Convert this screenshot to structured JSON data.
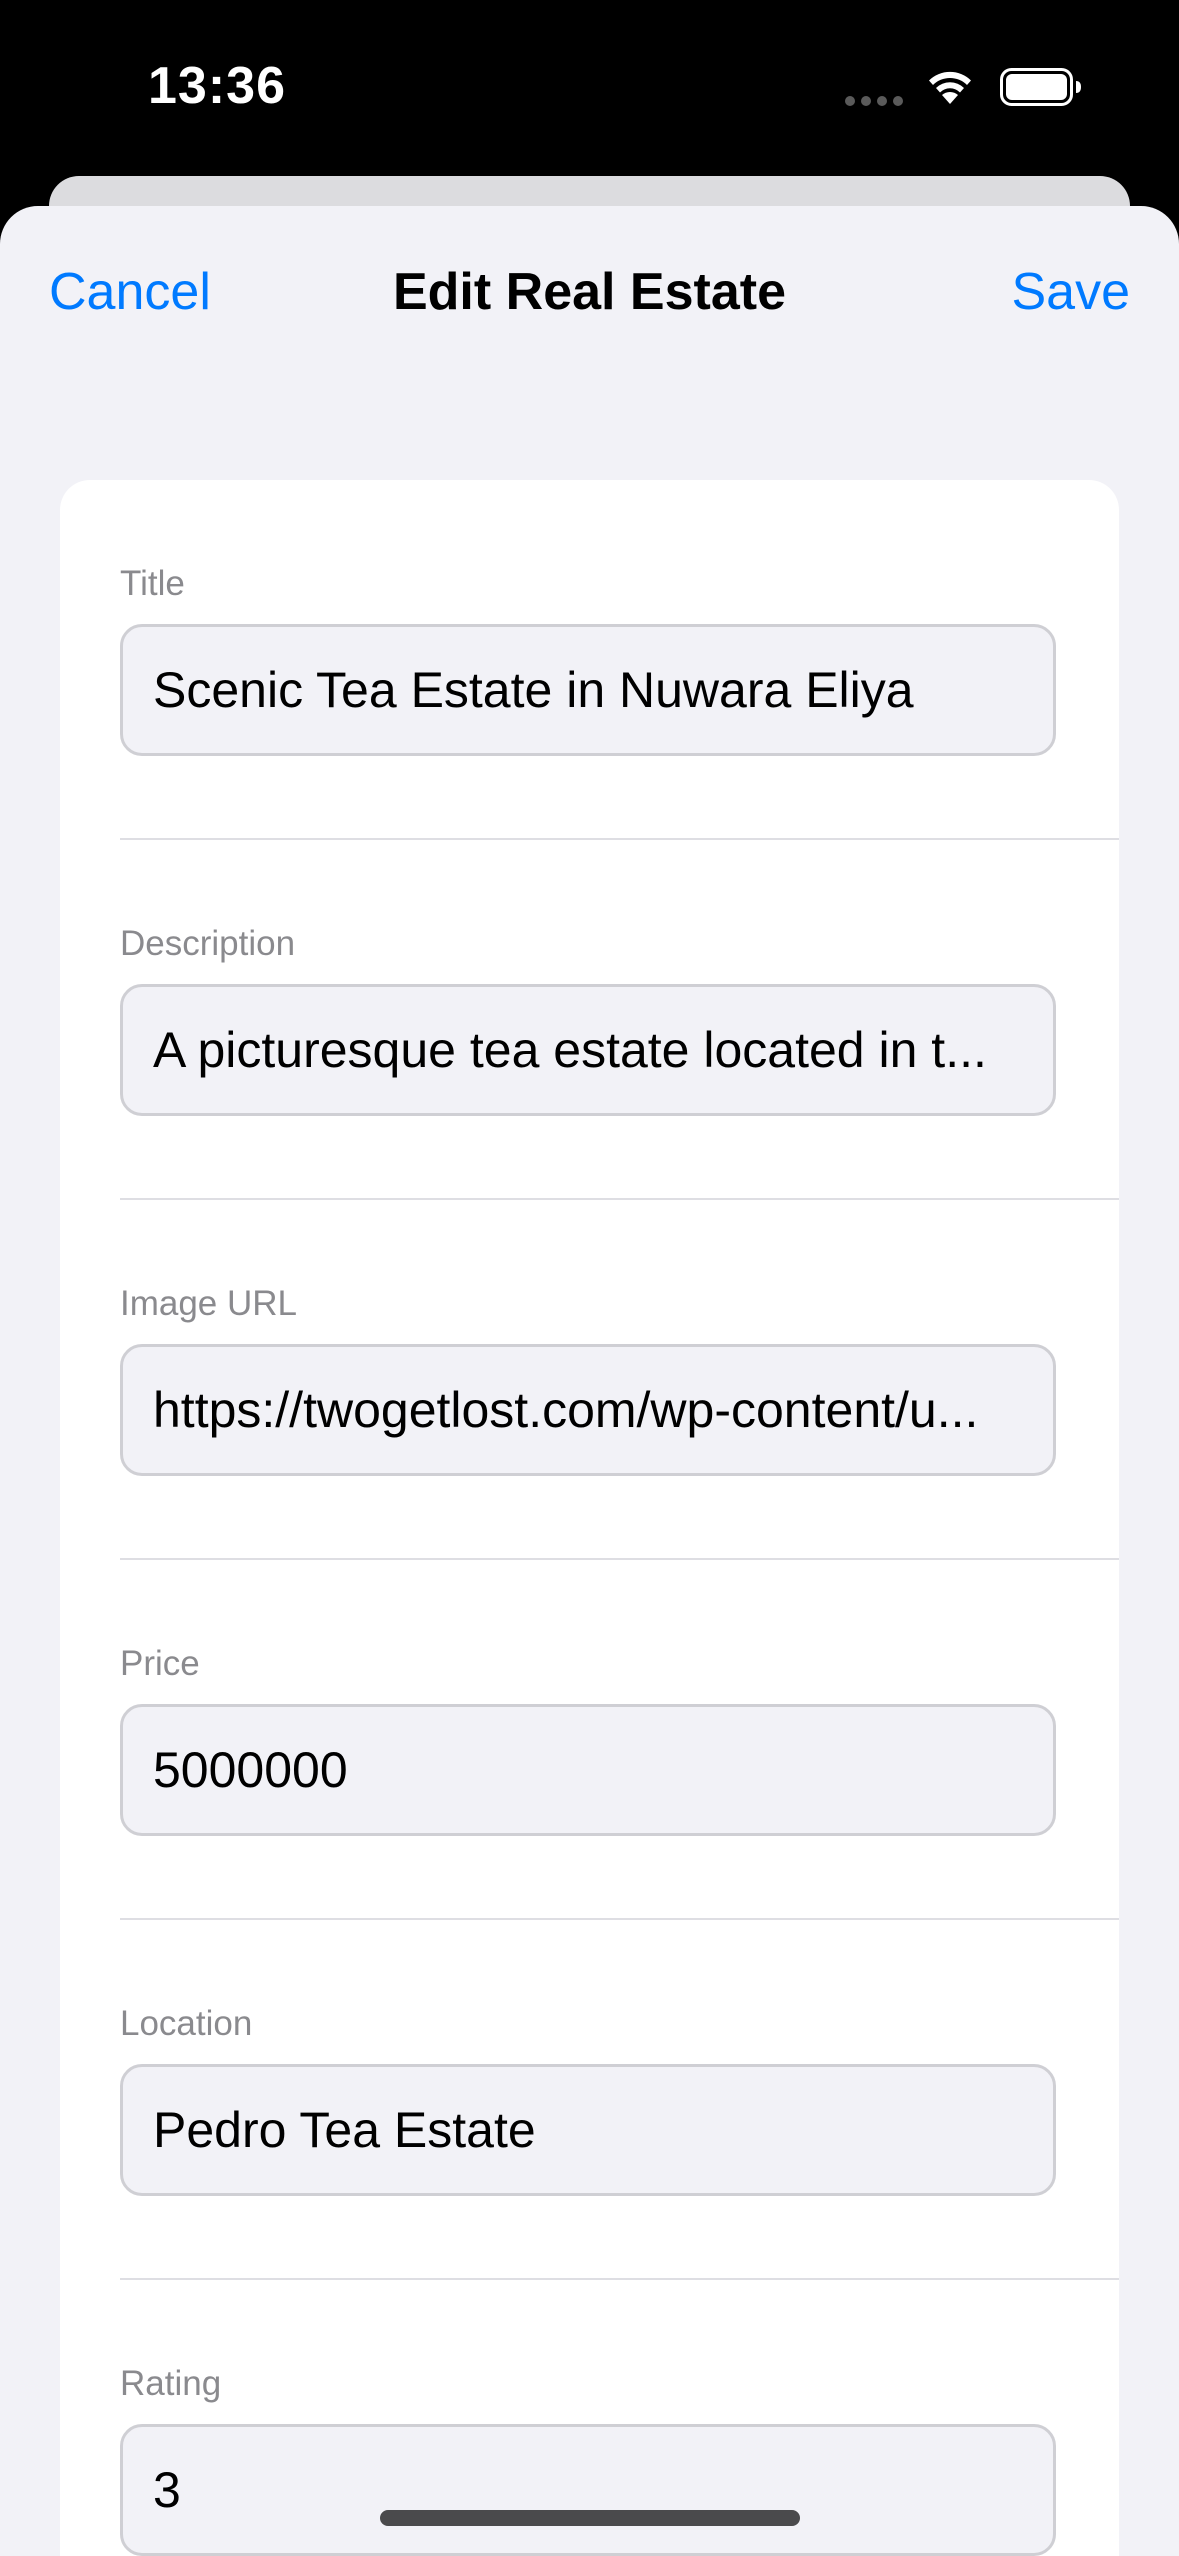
{
  "status_bar": {
    "time": "13:36",
    "icons": [
      "cellular-signal-icon",
      "wifi-icon",
      "battery-icon"
    ]
  },
  "nav": {
    "cancel_label": "Cancel",
    "title": "Edit Real Estate",
    "save_label": "Save"
  },
  "form": {
    "fields": [
      {
        "label": "Title",
        "value": "Scenic Tea Estate in Nuwara Eliya"
      },
      {
        "label": "Description",
        "value": "A picturesque tea estate located in t..."
      },
      {
        "label": "Image URL",
        "value": "https://twogetlost.com/wp-content/u..."
      },
      {
        "label": "Price",
        "value": "5000000"
      },
      {
        "label": "Location",
        "value": "Pedro Tea Estate"
      },
      {
        "label": "Rating",
        "value": "3"
      }
    ]
  },
  "colors": {
    "accent": "#007aff",
    "sheet_background": "#f2f2f7",
    "card_background": "#ffffff",
    "label_gray": "#8a8a8e"
  }
}
